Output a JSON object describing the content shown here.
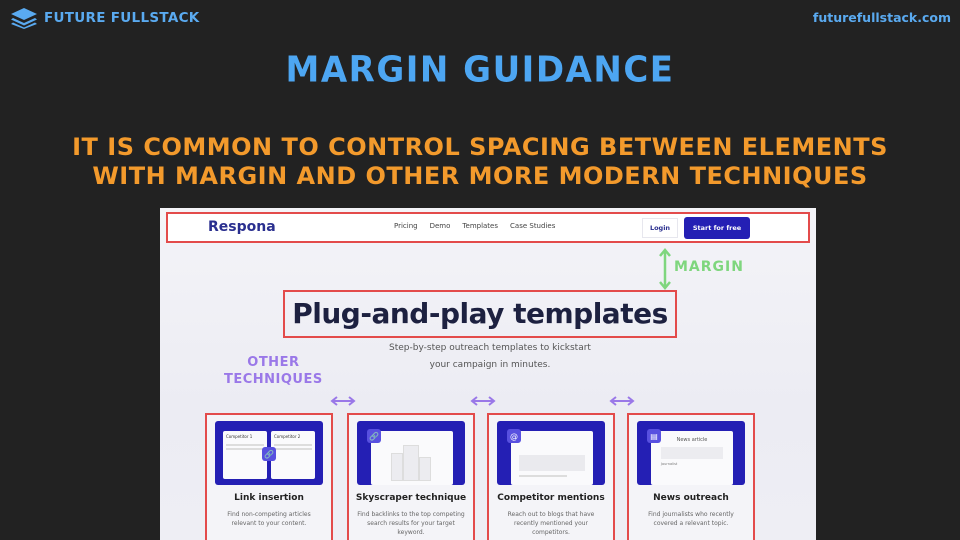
{
  "brand": {
    "name": "FUTURE FULLSTACK",
    "url": "futurefullstack.com"
  },
  "slide": {
    "title": "MARGIN GUIDANCE",
    "subtitle": "IT IS COMMON TO CONTROL SPACING BETWEEN ELEMENTS WITH MARGIN AND OTHER MORE MODERN TECHNIQUES"
  },
  "annotations": {
    "margin_label": "MARGIN",
    "other_line1": "OTHER",
    "other_line2": "TECHNIQUES",
    "box_color": "#e34b4b",
    "margin_color": "#7fd67e",
    "other_color": "#9a78e8"
  },
  "screenshot": {
    "nav": {
      "logo": "Respona",
      "links": [
        "Pricing",
        "Demo",
        "Templates",
        "Case Studies"
      ],
      "login": "Login",
      "start": "Start for free"
    },
    "hero": {
      "title": "Plug-and-play templates",
      "subtitle_line1": "Step-by-step outreach templates to kickstart",
      "subtitle_line2": "your campaign in minutes."
    },
    "cards": [
      {
        "title": "Link insertion",
        "desc": "Find non-competing articles relevant to your content.",
        "icon": "link-icon"
      },
      {
        "title": "Skyscraper technique",
        "desc": "Find backlinks to the top competing search results for your target keyword.",
        "icon": "link-icon"
      },
      {
        "title": "Competitor mentions",
        "desc": "Reach out to blogs that have recently mentioned your competitors.",
        "icon": "at-icon"
      },
      {
        "title": "News outreach",
        "desc": "Find journalists who recently covered a relevant topic.",
        "icon": "news-icon"
      }
    ],
    "card_thumb_texts": {
      "competitor1": "Competitor 1",
      "competitor2": "Competitor 2",
      "news_article": "News article",
      "journalist": "Journalist"
    }
  }
}
